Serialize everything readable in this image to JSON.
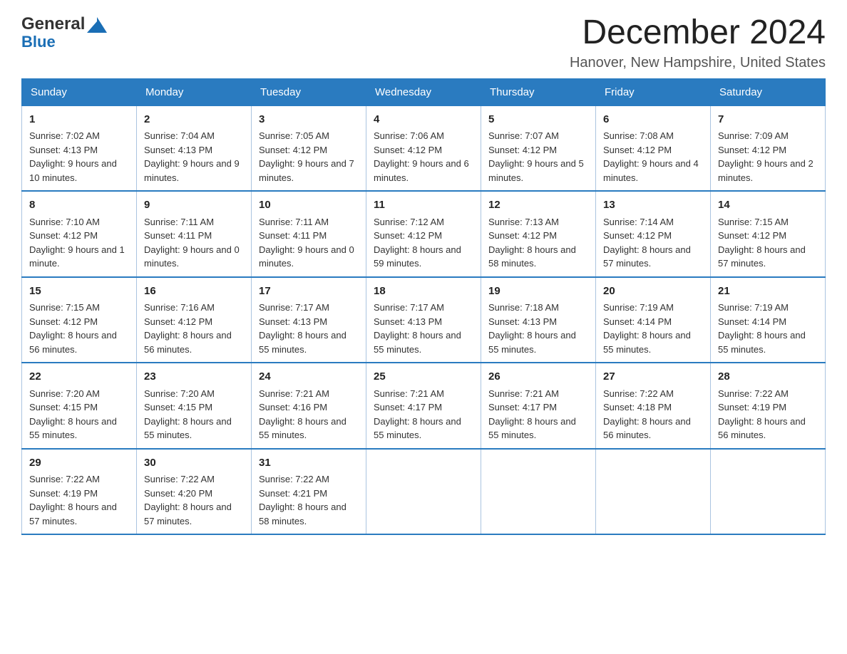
{
  "logo": {
    "general": "General",
    "blue": "Blue"
  },
  "title": "December 2024",
  "subtitle": "Hanover, New Hampshire, United States",
  "days_of_week": [
    "Sunday",
    "Monday",
    "Tuesday",
    "Wednesday",
    "Thursday",
    "Friday",
    "Saturday"
  ],
  "weeks": [
    [
      {
        "day": "1",
        "sunrise": "7:02 AM",
        "sunset": "4:13 PM",
        "daylight": "9 hours and 10 minutes."
      },
      {
        "day": "2",
        "sunrise": "7:04 AM",
        "sunset": "4:13 PM",
        "daylight": "9 hours and 9 minutes."
      },
      {
        "day": "3",
        "sunrise": "7:05 AM",
        "sunset": "4:12 PM",
        "daylight": "9 hours and 7 minutes."
      },
      {
        "day": "4",
        "sunrise": "7:06 AM",
        "sunset": "4:12 PM",
        "daylight": "9 hours and 6 minutes."
      },
      {
        "day": "5",
        "sunrise": "7:07 AM",
        "sunset": "4:12 PM",
        "daylight": "9 hours and 5 minutes."
      },
      {
        "day": "6",
        "sunrise": "7:08 AM",
        "sunset": "4:12 PM",
        "daylight": "9 hours and 4 minutes."
      },
      {
        "day": "7",
        "sunrise": "7:09 AM",
        "sunset": "4:12 PM",
        "daylight": "9 hours and 2 minutes."
      }
    ],
    [
      {
        "day": "8",
        "sunrise": "7:10 AM",
        "sunset": "4:12 PM",
        "daylight": "9 hours and 1 minute."
      },
      {
        "day": "9",
        "sunrise": "7:11 AM",
        "sunset": "4:11 PM",
        "daylight": "9 hours and 0 minutes."
      },
      {
        "day": "10",
        "sunrise": "7:11 AM",
        "sunset": "4:11 PM",
        "daylight": "9 hours and 0 minutes."
      },
      {
        "day": "11",
        "sunrise": "7:12 AM",
        "sunset": "4:12 PM",
        "daylight": "8 hours and 59 minutes."
      },
      {
        "day": "12",
        "sunrise": "7:13 AM",
        "sunset": "4:12 PM",
        "daylight": "8 hours and 58 minutes."
      },
      {
        "day": "13",
        "sunrise": "7:14 AM",
        "sunset": "4:12 PM",
        "daylight": "8 hours and 57 minutes."
      },
      {
        "day": "14",
        "sunrise": "7:15 AM",
        "sunset": "4:12 PM",
        "daylight": "8 hours and 57 minutes."
      }
    ],
    [
      {
        "day": "15",
        "sunrise": "7:15 AM",
        "sunset": "4:12 PM",
        "daylight": "8 hours and 56 minutes."
      },
      {
        "day": "16",
        "sunrise": "7:16 AM",
        "sunset": "4:12 PM",
        "daylight": "8 hours and 56 minutes."
      },
      {
        "day": "17",
        "sunrise": "7:17 AM",
        "sunset": "4:13 PM",
        "daylight": "8 hours and 55 minutes."
      },
      {
        "day": "18",
        "sunrise": "7:17 AM",
        "sunset": "4:13 PM",
        "daylight": "8 hours and 55 minutes."
      },
      {
        "day": "19",
        "sunrise": "7:18 AM",
        "sunset": "4:13 PM",
        "daylight": "8 hours and 55 minutes."
      },
      {
        "day": "20",
        "sunrise": "7:19 AM",
        "sunset": "4:14 PM",
        "daylight": "8 hours and 55 minutes."
      },
      {
        "day": "21",
        "sunrise": "7:19 AM",
        "sunset": "4:14 PM",
        "daylight": "8 hours and 55 minutes."
      }
    ],
    [
      {
        "day": "22",
        "sunrise": "7:20 AM",
        "sunset": "4:15 PM",
        "daylight": "8 hours and 55 minutes."
      },
      {
        "day": "23",
        "sunrise": "7:20 AM",
        "sunset": "4:15 PM",
        "daylight": "8 hours and 55 minutes."
      },
      {
        "day": "24",
        "sunrise": "7:21 AM",
        "sunset": "4:16 PM",
        "daylight": "8 hours and 55 minutes."
      },
      {
        "day": "25",
        "sunrise": "7:21 AM",
        "sunset": "4:17 PM",
        "daylight": "8 hours and 55 minutes."
      },
      {
        "day": "26",
        "sunrise": "7:21 AM",
        "sunset": "4:17 PM",
        "daylight": "8 hours and 55 minutes."
      },
      {
        "day": "27",
        "sunrise": "7:22 AM",
        "sunset": "4:18 PM",
        "daylight": "8 hours and 56 minutes."
      },
      {
        "day": "28",
        "sunrise": "7:22 AM",
        "sunset": "4:19 PM",
        "daylight": "8 hours and 56 minutes."
      }
    ],
    [
      {
        "day": "29",
        "sunrise": "7:22 AM",
        "sunset": "4:19 PM",
        "daylight": "8 hours and 57 minutes."
      },
      {
        "day": "30",
        "sunrise": "7:22 AM",
        "sunset": "4:20 PM",
        "daylight": "8 hours and 57 minutes."
      },
      {
        "day": "31",
        "sunrise": "7:22 AM",
        "sunset": "4:21 PM",
        "daylight": "8 hours and 58 minutes."
      },
      null,
      null,
      null,
      null
    ]
  ],
  "labels": {
    "sunrise": "Sunrise: ",
    "sunset": "Sunset: ",
    "daylight": "Daylight: "
  }
}
